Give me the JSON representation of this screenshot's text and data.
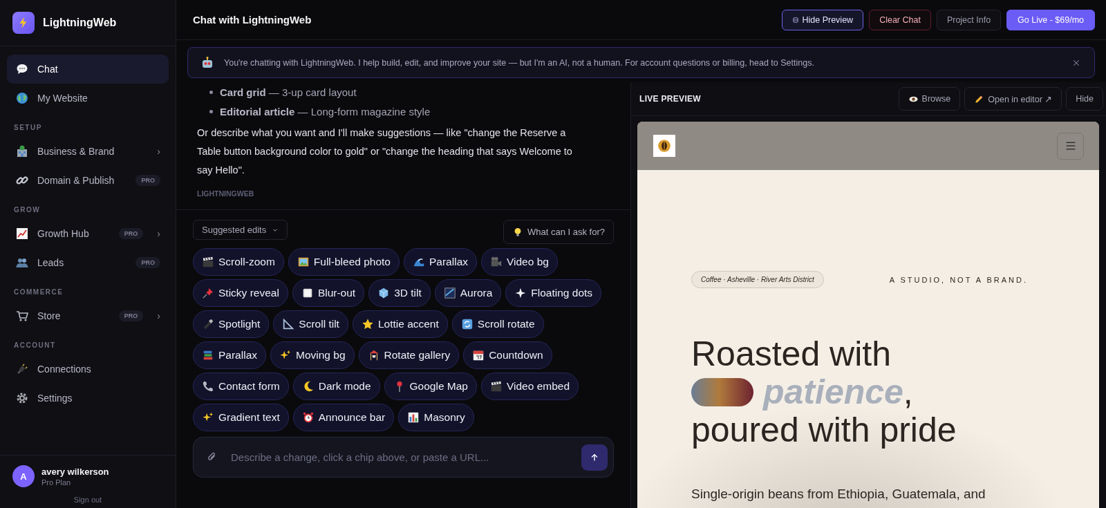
{
  "sidebar": {
    "brand": "LightningWeb",
    "nav": [
      {
        "items": [
          {
            "label": "Chat",
            "selected": true
          },
          {
            "label": "My Website",
            "selected": false
          }
        ]
      },
      {
        "heading": "SETUP",
        "items": [
          {
            "label": "Business & Brand",
            "selected": false,
            "chevron": "›"
          },
          {
            "label": "Domain & Publish",
            "selected": false,
            "badge": "PRO"
          }
        ]
      },
      {
        "heading": "GROW",
        "items": [
          {
            "label": "Growth Hub",
            "selected": false,
            "badge": "PRO",
            "chevron": "›"
          },
          {
            "label": "Leads",
            "selected": false,
            "badge": "PRO"
          }
        ]
      },
      {
        "heading": "COMMERCE",
        "items": [
          {
            "label": "Store",
            "selected": false,
            "badge": "PRO",
            "chevron": "›"
          }
        ]
      },
      {
        "heading": "ACCOUNT",
        "items": [
          {
            "label": "Connections",
            "selected": false
          },
          {
            "label": "Settings",
            "selected": false
          }
        ]
      }
    ],
    "user": {
      "initial": "A",
      "name": "avery wilkerson",
      "plan": "Pro Plan",
      "sign_out": "Sign out"
    }
  },
  "header": {
    "title": "Chat with LightningWeb",
    "buttons": [
      {
        "label": "Hide Preview",
        "kind": "toggle"
      },
      {
        "label": "Clear Chat",
        "kind": "danger"
      },
      {
        "label": "Project Info",
        "kind": "plain"
      },
      {
        "label": "Go Live - $69/mo",
        "kind": "primary"
      }
    ]
  },
  "banner": {
    "text": "You're chatting with LightningWeb. I help build, edit, and improve your site — but I'm an AI, not a human. For account questions or billing, head to Settings."
  },
  "chat": {
    "bullets": [
      "**Card grid** — 3-up card layout",
      "**Editorial article** — Long-form magazine style"
    ],
    "paragraph": "Or describe what you want and I'll make suggestions — like \"change the Reserve a Table button background color to gold\" or \"change the heading that says Welcome to say Hello\".",
    "sender": "LIGHTNINGWEB"
  },
  "composer": {
    "dropdown": "Suggested edits",
    "help": "What can I ask for?",
    "chip_rows": [
      [
        "Scroll-zoom",
        "Full-bleed photo",
        "Parallax",
        "Video bg"
      ],
      [
        "Sticky reveal",
        "Blur-out",
        "3D tilt",
        "Aurora",
        "Floating dots"
      ],
      [
        "Spotlight",
        "Scroll tilt",
        "Lottie accent",
        "Scroll rotate"
      ],
      [
        "Parallax",
        "Moving bg",
        "Rotate gallery",
        "Countdown"
      ],
      [
        "Contact form",
        "Dark mode",
        "Google Map",
        "Video embed"
      ],
      [
        "Gradient text",
        "Announce bar",
        "Masonry"
      ]
    ],
    "placeholder": "Describe a change, click a chip above, or paste a URL..."
  },
  "preview": {
    "title": "LIVE PREVIEW",
    "buttons": [
      "Browse",
      "Open in editor ↗",
      "Hide"
    ],
    "site": {
      "tag": "Coffee · Asheville · River Arts District",
      "tagline": "A STUDIO, NOT A BRAND.",
      "heading_start": "Roasted with",
      "highlight": "patience",
      "comma": ",",
      "heading_end": "poured with pride",
      "paragraph": "Single-origin beans from Ethiopia, Guatemala, and"
    }
  }
}
